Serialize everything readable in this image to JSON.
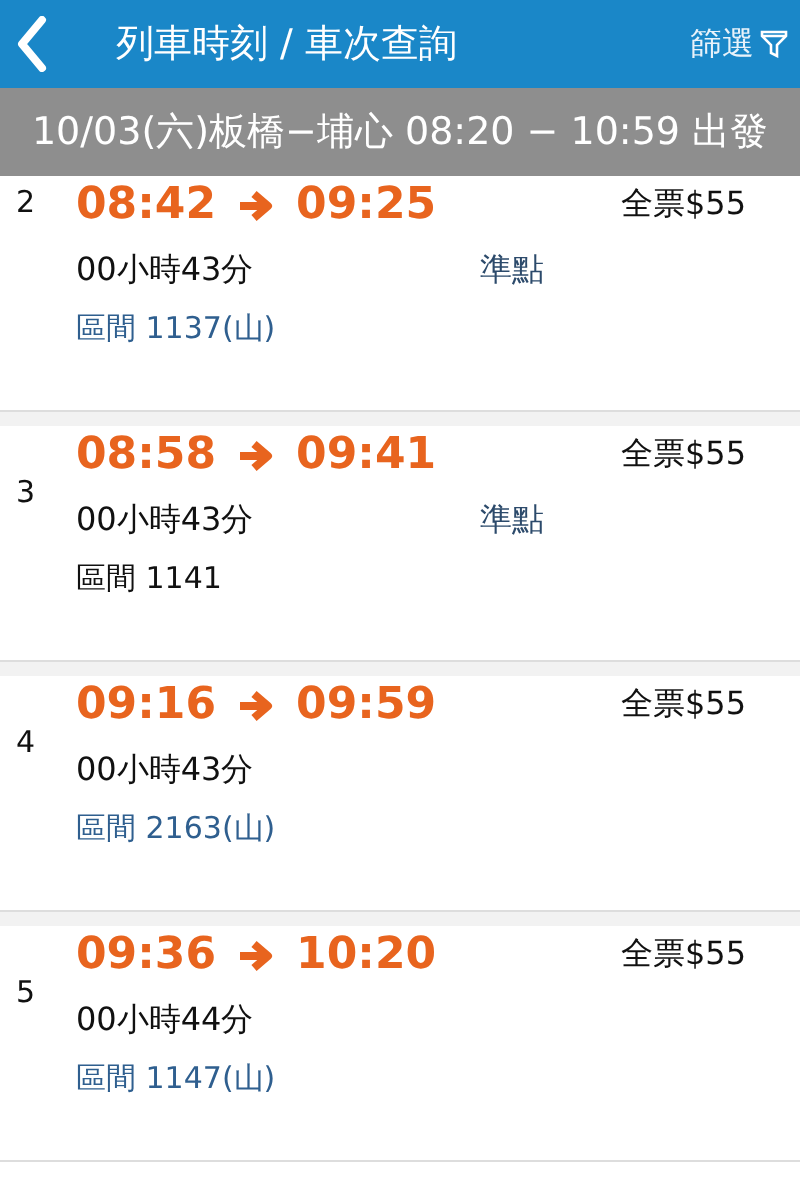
{
  "header": {
    "title": "列車時刻 / 車次查詢",
    "filter_label": "篩選"
  },
  "query_bar": {
    "text": "10/03(六)板橋−埔心 08:20 − 10:59 出發"
  },
  "trips": [
    {
      "number": "2",
      "depart": "08:42",
      "arrive": "09:25",
      "price": "全票$55",
      "duration": "00小時43分",
      "status": "準點",
      "train": "區間 1137(山)",
      "highlighted": true
    },
    {
      "number": "3",
      "depart": "08:58",
      "arrive": "09:41",
      "price": "全票$55",
      "duration": "00小時43分",
      "status": "準點",
      "train": "區間 1141",
      "highlighted": false
    },
    {
      "number": "4",
      "depart": "09:16",
      "arrive": "09:59",
      "price": "全票$55",
      "duration": "00小時43分",
      "train": "區間 2163(山)",
      "highlighted": true
    },
    {
      "number": "5",
      "depart": "09:36",
      "arrive": "10:20",
      "price": "全票$55",
      "duration": "00小時44分",
      "train": "區間 1147(山)",
      "highlighted": true
    }
  ]
}
